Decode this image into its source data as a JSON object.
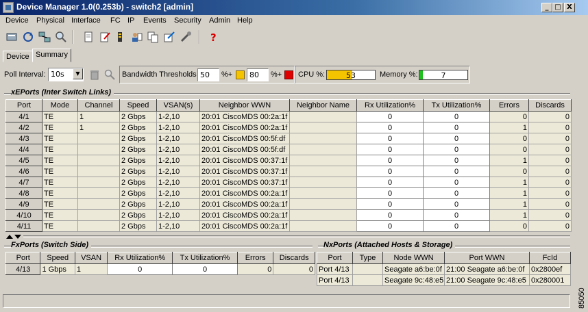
{
  "window": {
    "title": "Device Manager 1.0(0.253b) - switch2 [admin]",
    "buttons": [
      "_",
      "□",
      "X"
    ]
  },
  "menu": [
    "Device",
    "Physical",
    "Interface",
    "FC",
    "IP",
    "Events",
    "Security",
    "Admin",
    "Help"
  ],
  "toolbar_icons": [
    "device-icon",
    "refresh-icon",
    "map-icon",
    "find-icon",
    "document-icon",
    "edit-icon",
    "log-icon",
    "users-icon",
    "copy-icon",
    "export-icon",
    "tools-icon",
    "help-icon"
  ],
  "tabs": {
    "device": "Device",
    "summary": "Summary"
  },
  "poll": {
    "label": "Poll Interval:",
    "value": "10s",
    "bandwidth_label": "Bandwidth Thresholds",
    "threshold1": "50",
    "threshold1_unit": "%+",
    "threshold2": "80",
    "threshold2_unit": "%+",
    "color_yellow": "#f5c400",
    "color_red": "#e00000"
  },
  "cpu": {
    "label": "CPU %:",
    "value": "53",
    "fraction": 0.53,
    "color": "#f5c400"
  },
  "memory": {
    "label": "Memory %:",
    "value": "7",
    "fraction": 0.07,
    "color": "#1fc01f"
  },
  "xeports": {
    "heading": "xEPorts (Inter Switch Links)",
    "columns": [
      "Port",
      "Mode",
      "Channel",
      "Speed",
      "VSAN(s)",
      "Neighbor WWN",
      "Neighbor Name",
      "Rx Utilization%",
      "Tx Utilization%",
      "Errors",
      "Discards"
    ],
    "rows": [
      [
        "4/1",
        "TE",
        "1",
        "2 Gbps",
        "1-2,10",
        "20:01 CiscoMDS 00:2a:1f",
        "",
        "0",
        "0",
        "0",
        "0"
      ],
      [
        "4/2",
        "TE",
        "1",
        "2 Gbps",
        "1-2,10",
        "20:01 CiscoMDS 00:2a:1f",
        "",
        "0",
        "0",
        "1",
        "0"
      ],
      [
        "4/3",
        "TE",
        "",
        "2 Gbps",
        "1-2,10",
        "20:01 CiscoMDS 00:5f:df",
        "",
        "0",
        "0",
        "0",
        "0"
      ],
      [
        "4/4",
        "TE",
        "",
        "2 Gbps",
        "1-2,10",
        "20:01 CiscoMDS 00:5f:df",
        "",
        "0",
        "0",
        "0",
        "0"
      ],
      [
        "4/5",
        "TE",
        "",
        "2 Gbps",
        "1-2,10",
        "20:01 CiscoMDS 00:37:1f",
        "",
        "0",
        "0",
        "1",
        "0"
      ],
      [
        "4/6",
        "TE",
        "",
        "2 Gbps",
        "1-2,10",
        "20:01 CiscoMDS 00:37:1f",
        "",
        "0",
        "0",
        "0",
        "0"
      ],
      [
        "4/7",
        "TE",
        "",
        "2 Gbps",
        "1-2,10",
        "20:01 CiscoMDS 00:37:1f",
        "",
        "0",
        "0",
        "1",
        "0"
      ],
      [
        "4/8",
        "TE",
        "",
        "2 Gbps",
        "1-2,10",
        "20:01 CiscoMDS 00:2a:1f",
        "",
        "0",
        "0",
        "1",
        "0"
      ],
      [
        "4/9",
        "TE",
        "",
        "2 Gbps",
        "1-2,10",
        "20:01 CiscoMDS 00:2a:1f",
        "",
        "0",
        "0",
        "1",
        "0"
      ],
      [
        "4/10",
        "TE",
        "",
        "2 Gbps",
        "1-2,10",
        "20:01 CiscoMDS 00:2a:1f",
        "",
        "0",
        "0",
        "1",
        "0"
      ],
      [
        "4/11",
        "TE",
        "",
        "2 Gbps",
        "1-2,10",
        "20:01 CiscoMDS 00:2a:1f",
        "",
        "0",
        "0",
        "0",
        "0"
      ]
    ]
  },
  "fxports": {
    "heading": "FxPorts (Switch Side)",
    "columns": [
      "Port",
      "Speed",
      "VSAN",
      "Rx Utilization%",
      "Tx Utilization%",
      "Errors",
      "Discards"
    ],
    "rows": [
      [
        "4/13",
        "1 Gbps",
        "1",
        "0",
        "0",
        "0",
        "0"
      ]
    ]
  },
  "nxports": {
    "heading": "NxPorts (Attached Hosts & Storage)",
    "columns": [
      "Port",
      "Type",
      "Node WWN",
      "Port WWN",
      "FcId"
    ],
    "rows": [
      [
        "Port 4/13",
        "",
        "Seagate a6:be:0f",
        "21:00 Seagate a6:be:0f",
        "0x2800ef"
      ],
      [
        "Port 4/13",
        "",
        "Seagate 9c:48:e5",
        "21:00 Seagate 9c:48:e5",
        "0x280001"
      ]
    ]
  },
  "side_code": "85050"
}
